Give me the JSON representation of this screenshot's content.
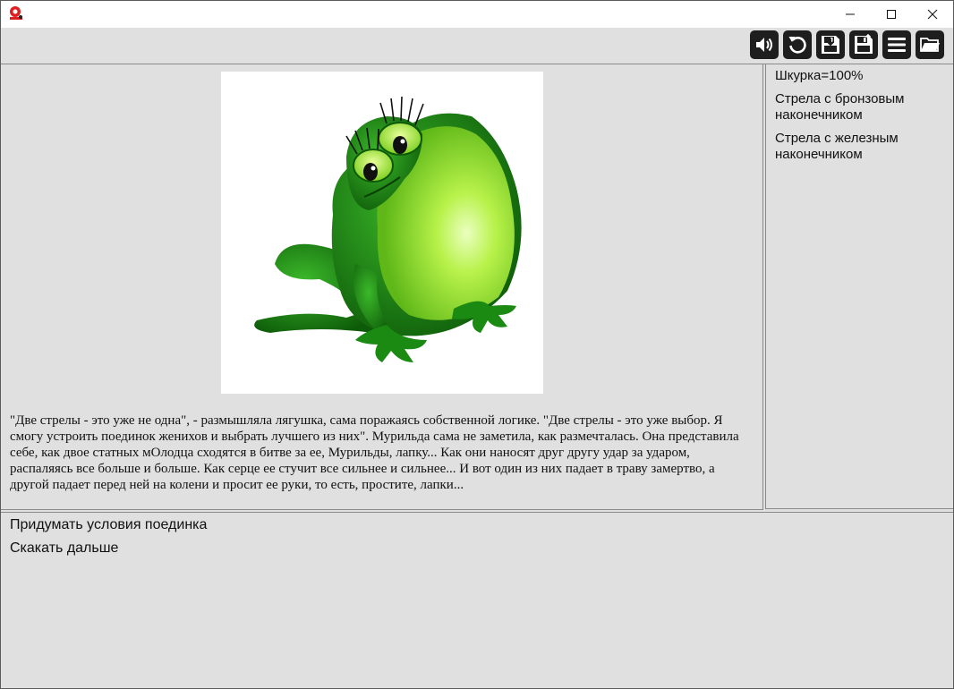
{
  "window": {
    "controls": [
      "minimize-icon",
      "maximize-icon",
      "close-icon"
    ]
  },
  "toolbar": {
    "buttons": [
      "sound-icon",
      "restart-icon",
      "save-icon",
      "quick-save-icon",
      "menu-icon",
      "open-folder-icon"
    ]
  },
  "colors": {
    "background": "#e0e0e0",
    "toolbar_button": "#1e1e1e",
    "app_icon": "#e02020",
    "frog_green": "#1f8a12",
    "frog_belly": "#a6f03a"
  },
  "main": {
    "image": "frog-picture",
    "story": "\"Две стрелы - это уже не одна\", - размышляла лягушка, сама поражаясь собственной логике. \"Две стрелы - это уже выбор. Я смогу устроить поединок женихов и выбрать лучшего из них\". Мурильда сама не заметила, как размечталась. Она представила себе, как двое статных мОлодца сходятся в битве за ее, Мурильды, лапку... Как они наносят друг другу удар за ударом, распаляясь все больше и больше. Как серце ее стучит все сильнее и сильнее... И вот один из них падает в траву замертво, а другой падает перед ней на колени и просит ее руки, то есть, простите, лапки..."
  },
  "side": {
    "items": [
      {
        "text": "Шкурка=100%"
      },
      {
        "text": "Стрела с бронзовым наконечником"
      },
      {
        "text": "Стрела с железным наконечником"
      }
    ]
  },
  "actions": [
    {
      "label": "Придумать условия поединка"
    },
    {
      "label": "Скакать дальше"
    }
  ]
}
